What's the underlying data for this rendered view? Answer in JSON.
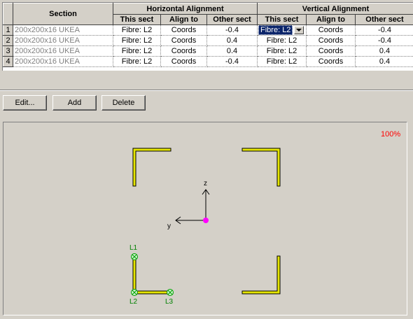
{
  "grid": {
    "headers": {
      "section": "Section",
      "horizontal_alignment": "Horizontal Alignment",
      "vertical_alignment": "Vertical Alignment",
      "this_sect": "This sect",
      "align_to": "Align to",
      "other_sect": "Other sect"
    },
    "rows": [
      {
        "num": "1",
        "section": "200x200x16 UKEA",
        "h_this": "Fibre: L2",
        "h_align": "Coords",
        "h_other": "-0.4",
        "v_this": "Fibre: L2",
        "v_align": "Coords",
        "v_other": "-0.4"
      },
      {
        "num": "2",
        "section": "200x200x16 UKEA",
        "h_this": "Fibre: L2",
        "h_align": "Coords",
        "h_other": "0.4",
        "v_this": "Fibre: L2",
        "v_align": "Coords",
        "v_other": "-0.4"
      },
      {
        "num": "3",
        "section": "200x200x16 UKEA",
        "h_this": "Fibre: L2",
        "h_align": "Coords",
        "h_other": "0.4",
        "v_this": "Fibre: L2",
        "v_align": "Coords",
        "v_other": "0.4"
      },
      {
        "num": "4",
        "section": "200x200x16 UKEA",
        "h_this": "Fibre: L2",
        "h_align": "Coords",
        "h_other": "-0.4",
        "v_this": "Fibre: L2",
        "v_align": "Coords",
        "v_other": "0.4"
      }
    ],
    "active_cell": {
      "row": 1,
      "column": "v_this"
    }
  },
  "buttons": {
    "edit": "Edit...",
    "add": "Add",
    "delete": "Delete"
  },
  "preview": {
    "zoom": "100%",
    "axis_z": "z",
    "axis_y": "y",
    "fibre_labels": {
      "l1": "L1",
      "l2": "L2",
      "l3": "L3"
    },
    "colors": {
      "section_fill": "#e6e600",
      "origin_point": "#ff00ff",
      "fibre_marker": "#00a000",
      "zoom_text": "#ff0000"
    }
  }
}
